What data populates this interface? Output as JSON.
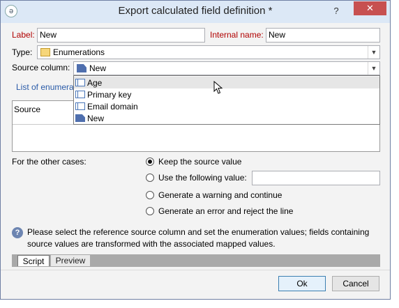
{
  "window": {
    "title": "Export calculated field definition *",
    "help": "?",
    "close": "✕"
  },
  "form": {
    "label_caption": "Label:",
    "label_value": "New",
    "internal_caption": "Internal name:",
    "internal_value": "New",
    "type_caption": "Type:",
    "type_value": "Enumerations",
    "source_caption": "Source column:",
    "source_value": "New",
    "list_link": "List of enumera",
    "panel_header": "Source"
  },
  "dropdown": {
    "items": [
      {
        "label": "Age",
        "icon": "table-column-icon"
      },
      {
        "label": "Primary key",
        "icon": "table-column-icon"
      },
      {
        "label": "Email domain",
        "icon": "table-column-icon"
      },
      {
        "label": "New",
        "icon": "calculated-field-icon"
      }
    ]
  },
  "other_cases": {
    "caption": "For the other cases:",
    "options": [
      {
        "label": "Keep the source value",
        "selected": true
      },
      {
        "label": "Use the following value:",
        "selected": false
      },
      {
        "label": "Generate a warning and continue",
        "selected": false
      },
      {
        "label": "Generate an error and reject the line",
        "selected": false
      }
    ],
    "value_input": ""
  },
  "info": {
    "text": "Please select the reference source column and set the enumeration values; fields containing source values are transformed with the associated mapped values."
  },
  "tabs": [
    {
      "label": "Script"
    },
    {
      "label": "Preview"
    }
  ],
  "buttons": {
    "ok": "Ok",
    "cancel": "Cancel"
  }
}
